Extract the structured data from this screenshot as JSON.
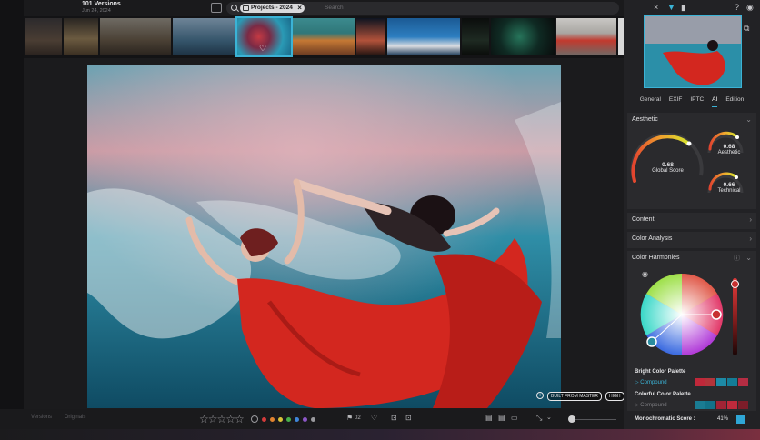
{
  "window": {
    "title": "101 Versions",
    "subtitle": "Jun 24, 2024"
  },
  "search": {
    "chip": "Projects - 2024",
    "placeholder": "Search"
  },
  "filmstrip": {
    "selected_index": 3,
    "count": 12
  },
  "viewer": {
    "badges": [
      "BUILT FROM MASTER",
      "HIGH"
    ],
    "info": "i"
  },
  "bottombar": {
    "left_items": [
      "Versions",
      "Originals"
    ],
    "stars": "☆☆☆☆☆",
    "color_labels": [
      "#7b7b7f",
      "#d33b3b",
      "#e0832f",
      "#d8c23a",
      "#47b04a",
      "#3f86d8",
      "#8c57c7",
      "#9a9a9e"
    ],
    "flag_count": "02"
  },
  "panel": {
    "tabs": [
      "General",
      "EXIF",
      "IPTC",
      "AI",
      "Edition"
    ],
    "active_tab": "AI",
    "aesthetic": {
      "title": "Aesthetic",
      "global": {
        "value": "0.68",
        "label": "Global Score"
      },
      "aesthetic": {
        "value": "0.68",
        "label": "Aesthetic"
      },
      "technical": {
        "value": "0.66",
        "label": "Technical"
      }
    },
    "sections": [
      "Content",
      "Color Analysis",
      "Color Harmonies"
    ],
    "palettes": {
      "bright": {
        "title": "Bright Color Palette",
        "mode": "Compound",
        "colors": [
          "#c0283a",
          "#b3343b",
          "#1d8aa6",
          "#147c96",
          "#b52d43"
        ]
      },
      "colorful": {
        "title": "Colorful Color Palette",
        "mode": "Compound",
        "colors": [
          "#1a7c93",
          "#127289",
          "#a12435",
          "#c02a3c",
          "#7d1d29"
        ]
      }
    },
    "monochromatic": {
      "label": "Monochromatic Score :",
      "value": "41%",
      "color": "#2fa6d6"
    }
  }
}
